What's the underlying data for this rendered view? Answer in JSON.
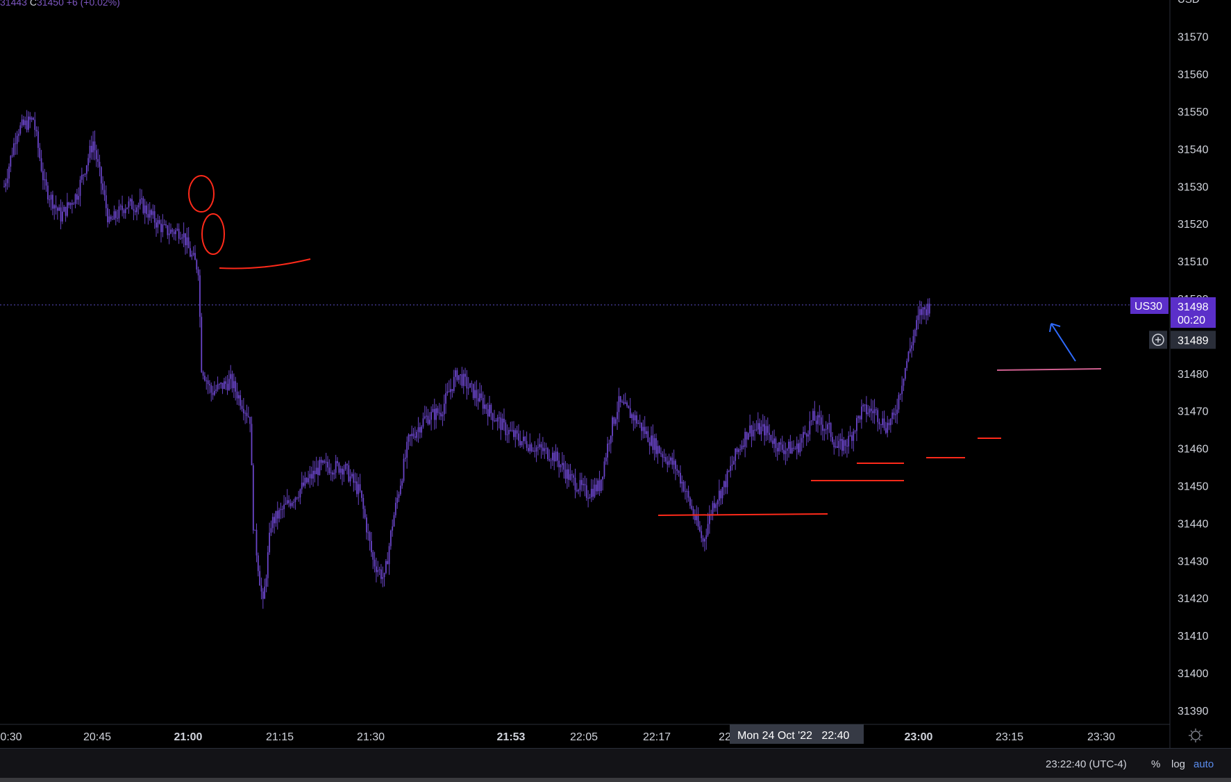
{
  "header": {
    "ohlc_prefix": "31443",
    "ohlc_c_label": "C",
    "ohlc_c_value": "31450",
    "ohlc_change": "+6 (+0.02%)"
  },
  "colors": {
    "background": "#000000",
    "candle": "#6a45c9",
    "annotation_red": "#ff2a1a",
    "annotation_blue": "#2f6bff",
    "annotation_pink": "#d06090",
    "price_badge": "#5b2fc9"
  },
  "chart_data": {
    "type": "candlestick",
    "symbol": "US30",
    "currency": "USD",
    "ylim": [
      31384,
      31590
    ],
    "y_ticks": [
      31570,
      31560,
      31550,
      31540,
      31530,
      31520,
      31510,
      31500,
      31480,
      31470,
      31460,
      31450,
      31440,
      31430,
      31420,
      31410,
      31400,
      31390
    ],
    "x_ticks": [
      {
        "label": "0:30",
        "bold": false
      },
      {
        "label": "20:45",
        "bold": false
      },
      {
        "label": "21:00",
        "bold": true
      },
      {
        "label": "21:15",
        "bold": false
      },
      {
        "label": "21:30",
        "bold": false
      },
      {
        "label": "21:53",
        "bold": true
      },
      {
        "label": "22:05",
        "bold": false
      },
      {
        "label": "22:17",
        "bold": false
      },
      {
        "label": "22",
        "bold": false
      },
      {
        "label": "23:00",
        "bold": true
      },
      {
        "label": "23:15",
        "bold": false
      },
      {
        "label": "23:30",
        "bold": false
      }
    ],
    "crosshair_time_label": "Mon 24 Oct '22   22:40",
    "current_price": {
      "symbol_label": "US30",
      "value": 31498,
      "countdown": "00:20"
    },
    "crosshair_price": 31489,
    "anchors": [
      [
        0,
        31530
      ],
      [
        8,
        31545
      ],
      [
        18,
        31548
      ],
      [
        25,
        31530
      ],
      [
        35,
        31522
      ],
      [
        45,
        31528
      ],
      [
        55,
        31542
      ],
      [
        65,
        31520
      ],
      [
        75,
        31525
      ],
      [
        85,
        31525
      ],
      [
        95,
        31520
      ],
      [
        100,
        31518
      ],
      [
        110,
        31518
      ],
      [
        115,
        31512
      ],
      [
        120,
        31508
      ],
      [
        122,
        31482
      ],
      [
        128,
        31475
      ],
      [
        140,
        31478
      ],
      [
        152,
        31468
      ],
      [
        154,
        31440
      ],
      [
        158,
        31425
      ],
      [
        160,
        31418
      ],
      [
        165,
        31440
      ],
      [
        175,
        31445
      ],
      [
        185,
        31450
      ],
      [
        195,
        31455
      ],
      [
        210,
        31455
      ],
      [
        220,
        31448
      ],
      [
        228,
        31430
      ],
      [
        235,
        31425
      ],
      [
        240,
        31440
      ],
      [
        250,
        31462
      ],
      [
        260,
        31468
      ],
      [
        270,
        31470
      ],
      [
        280,
        31480
      ],
      [
        290,
        31475
      ],
      [
        300,
        31470
      ],
      [
        310,
        31465
      ],
      [
        320,
        31462
      ],
      [
        330,
        31460
      ],
      [
        340,
        31458
      ],
      [
        350,
        31452
      ],
      [
        360,
        31448
      ],
      [
        368,
        31450
      ],
      [
        375,
        31465
      ],
      [
        380,
        31472
      ],
      [
        390,
        31468
      ],
      [
        400,
        31462
      ],
      [
        408,
        31458
      ],
      [
        415,
        31455
      ],
      [
        420,
        31450
      ],
      [
        428,
        31440
      ],
      [
        432,
        31435
      ],
      [
        438,
        31445
      ],
      [
        445,
        31450
      ],
      [
        452,
        31458
      ],
      [
        460,
        31465
      ],
      [
        470,
        31465
      ],
      [
        480,
        31460
      ],
      [
        490,
        31460
      ],
      [
        500,
        31468
      ],
      [
        510,
        31465
      ],
      [
        515,
        31460
      ],
      [
        522,
        31462
      ],
      [
        530,
        31470
      ],
      [
        538,
        31470
      ],
      [
        545,
        31466
      ],
      [
        550,
        31468
      ],
      [
        556,
        31480
      ],
      [
        562,
        31490
      ],
      [
        566,
        31496
      ],
      [
        572,
        31498
      ]
    ]
  },
  "bottom_bar": {
    "time": "23:22:40 (UTC-4)",
    "percent": "%",
    "log": "log",
    "auto": "auto"
  }
}
